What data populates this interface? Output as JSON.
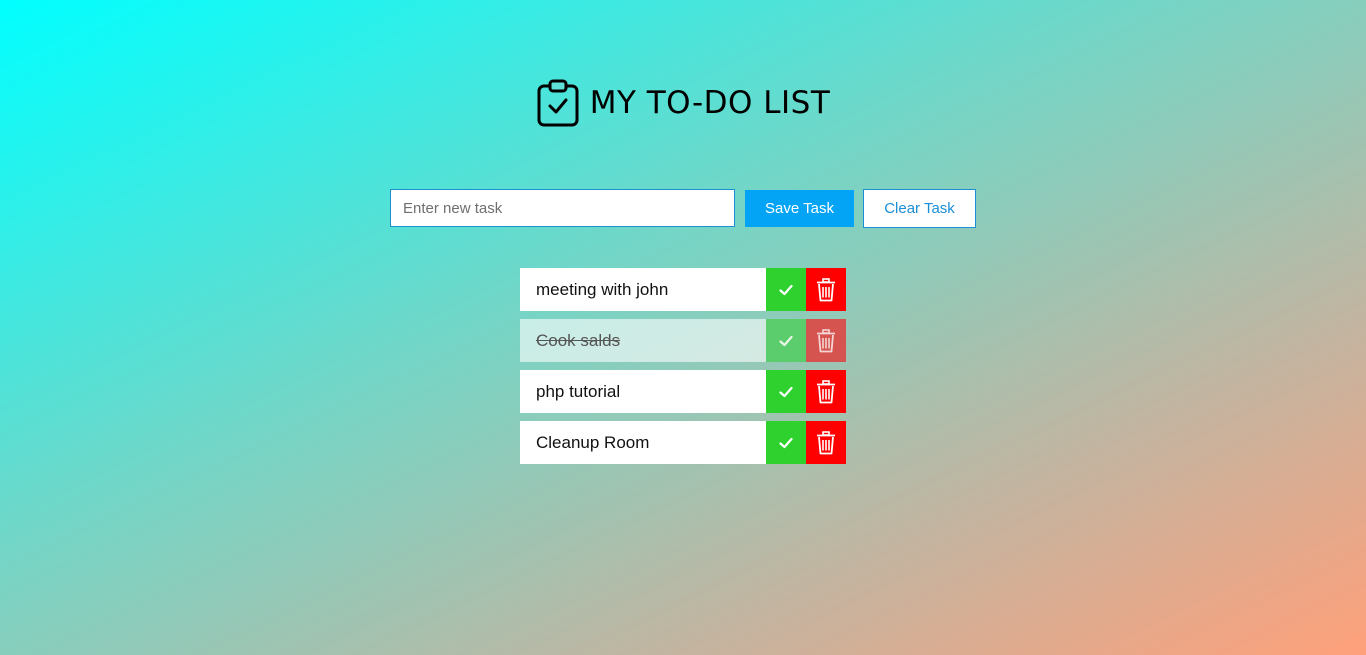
{
  "header": {
    "title": "MY TO-DO LIST",
    "icon": "clipboard-check-icon"
  },
  "form": {
    "input_placeholder": "Enter new task",
    "input_value": "",
    "save_label": "Save Task",
    "clear_label": "Clear Task"
  },
  "colors": {
    "save_button": "#03a3f5",
    "complete_button": "#2fd12f",
    "delete_button": "#ff0000",
    "accent_border": "#1b8fd6"
  },
  "tasks": [
    {
      "text": "meeting with john",
      "completed": false
    },
    {
      "text": "Cook salds",
      "completed": true
    },
    {
      "text": "php tutorial",
      "completed": false
    },
    {
      "text": "Cleanup Room",
      "completed": false
    }
  ]
}
